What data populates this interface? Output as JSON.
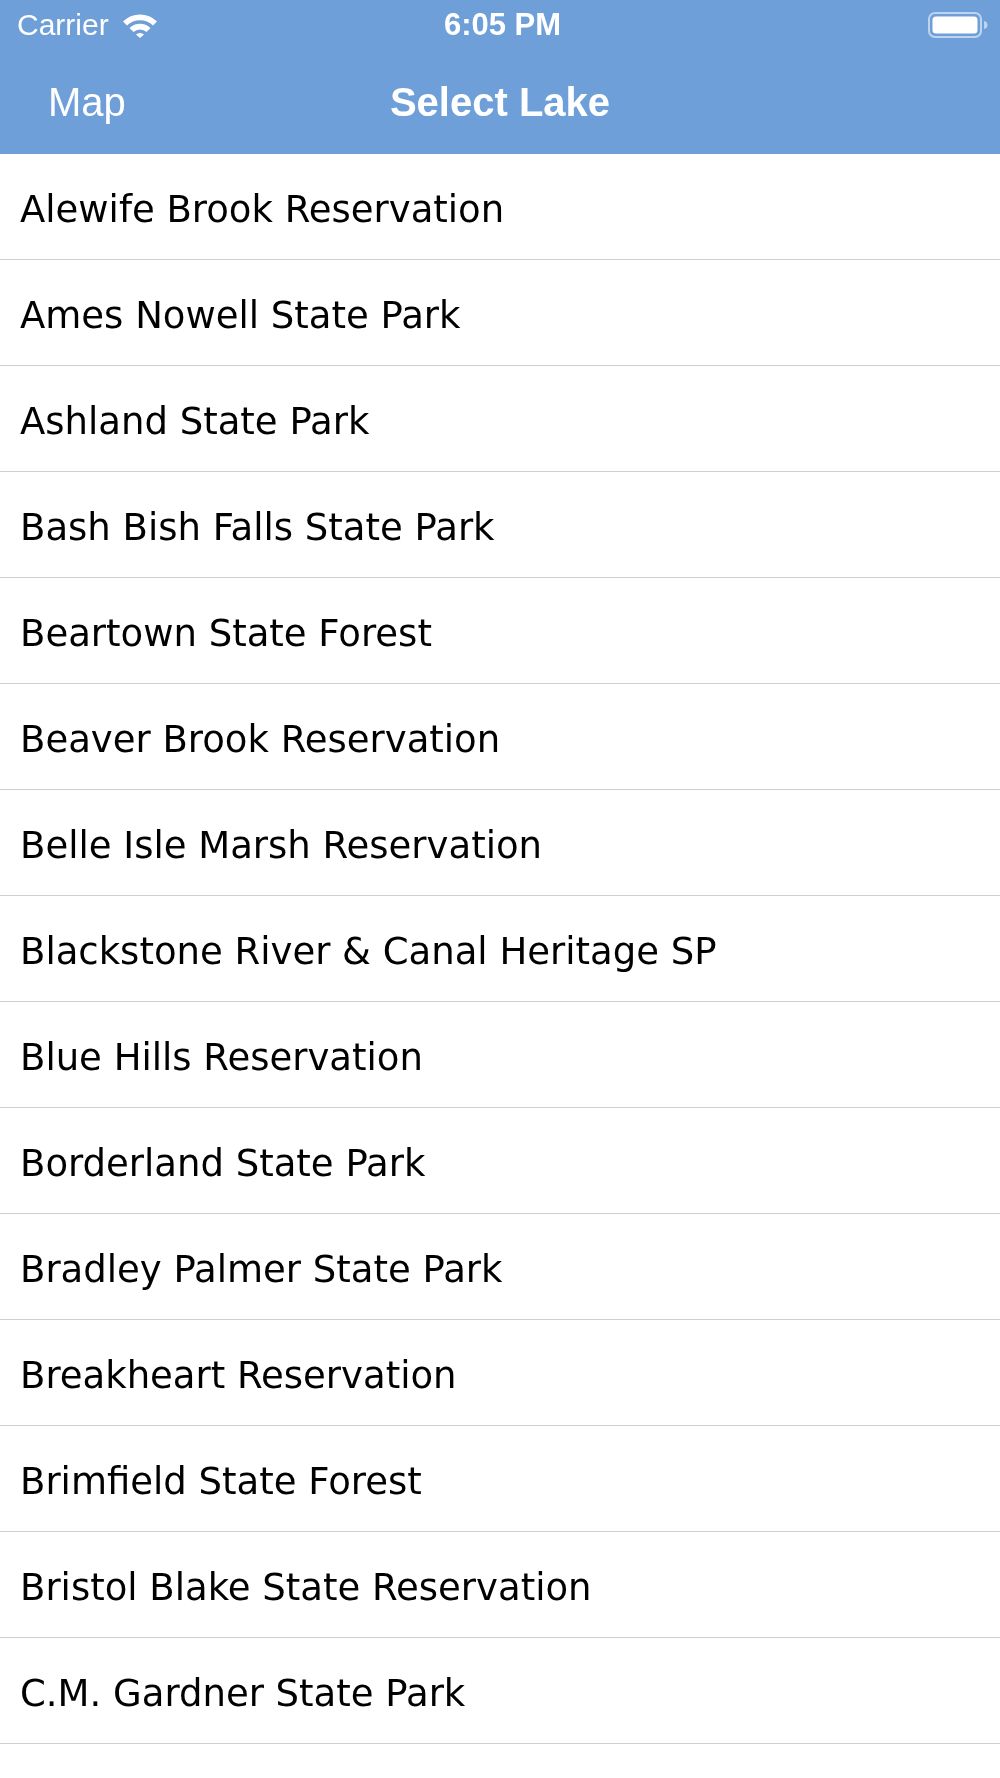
{
  "status_bar": {
    "carrier": "Carrier",
    "time": "6:05 PM"
  },
  "nav_bar": {
    "back_button": "Map",
    "title": "Select Lake"
  },
  "lakes": [
    {
      "name": "Alewife Brook Reservation"
    },
    {
      "name": "Ames Nowell State Park"
    },
    {
      "name": "Ashland State Park"
    },
    {
      "name": "Bash Bish Falls State Park"
    },
    {
      "name": "Beartown State Forest"
    },
    {
      "name": "Beaver Brook Reservation"
    },
    {
      "name": "Belle Isle Marsh Reservation"
    },
    {
      "name": "Blackstone River & Canal Heritage SP"
    },
    {
      "name": "Blue Hills Reservation"
    },
    {
      "name": "Borderland State Park"
    },
    {
      "name": "Bradley Palmer State Park"
    },
    {
      "name": "Breakheart Reservation"
    },
    {
      "name": "Brimfield State Forest"
    },
    {
      "name": "Bristol Blake State Reservation"
    },
    {
      "name": "C.M. Gardner State Park"
    }
  ]
}
